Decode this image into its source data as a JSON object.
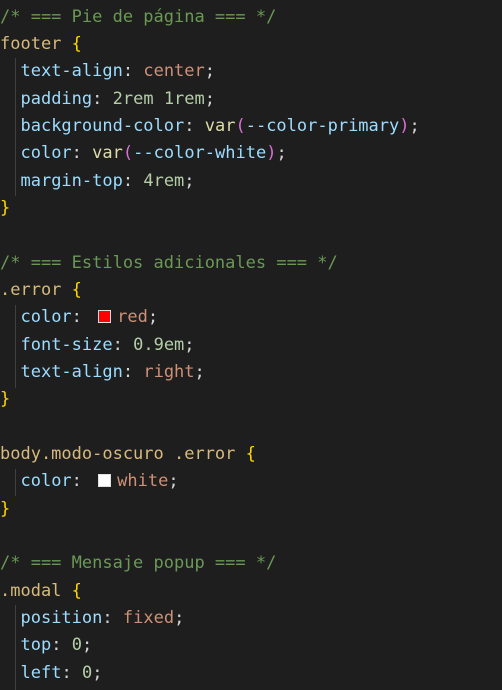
{
  "code": {
    "comment_footer": "/* === Pie de página === */",
    "footer_selector": "footer",
    "text_align_prop": "text-align",
    "center_val": "center",
    "padding_prop": "padding",
    "padding_val": "2rem 1rem",
    "bg_color_prop": "background-color",
    "var_func": "var",
    "color_primary": "--color-primary",
    "color_prop": "color",
    "color_white_var": "--color-white",
    "margin_top_prop": "margin-top",
    "margin_top_val": "4rem",
    "comment_extra": "/* === Estilos adicionales === */",
    "error_selector": ".error",
    "red_val": "red",
    "font_size_prop": "font-size",
    "font_size_val": "0.9em",
    "right_val": "right",
    "dark_selector": "body.modo-oscuro .error",
    "white_val": "white",
    "comment_popup": "/* === Mensaje popup === */",
    "modal_selector": ".modal",
    "position_prop": "position",
    "fixed_val": "fixed",
    "top_prop": "top",
    "zero_val": "0",
    "left_prop": "left",
    "open_brace": "{",
    "close_brace": "}",
    "colon": ":",
    "semicolon": ";",
    "open_paren": "(",
    "close_paren": ")"
  },
  "swatches": {
    "red": "#ff0000",
    "white": "#ffffff"
  },
  "colors": {
    "background": "#1e1e1e",
    "comment": "#6a9955",
    "selector": "#d7ba7d",
    "brace": "#ffd700",
    "property": "#9cdcfe",
    "value": "#ce9178",
    "number": "#b5cea8",
    "function": "#dcdcaa",
    "paren": "#da70d6"
  }
}
